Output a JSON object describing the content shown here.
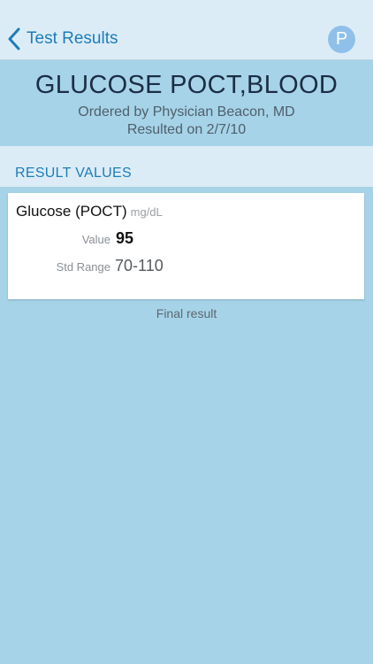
{
  "nav": {
    "back_label": "Test Results",
    "avatar_initial": "P"
  },
  "header": {
    "title": "GLUCOSE POCT,BLOOD",
    "ordered_by": "Ordered by Physician Beacon, MD",
    "resulted_on": "Resulted on 2/7/10"
  },
  "section": {
    "title": "RESULT VALUES"
  },
  "result": {
    "name": "Glucose (POCT)",
    "unit": "mg/dL",
    "value_label": "Value",
    "value": "95",
    "range_label": "Std Range",
    "range": "70-110"
  },
  "footer": {
    "note": "Final result"
  },
  "colors": {
    "accent": "#1d7db9",
    "background": "#a6d3e8",
    "bar": "#dcecf6",
    "avatar": "#8fc0ea"
  },
  "icons": {
    "back": "chevron-left-icon"
  }
}
